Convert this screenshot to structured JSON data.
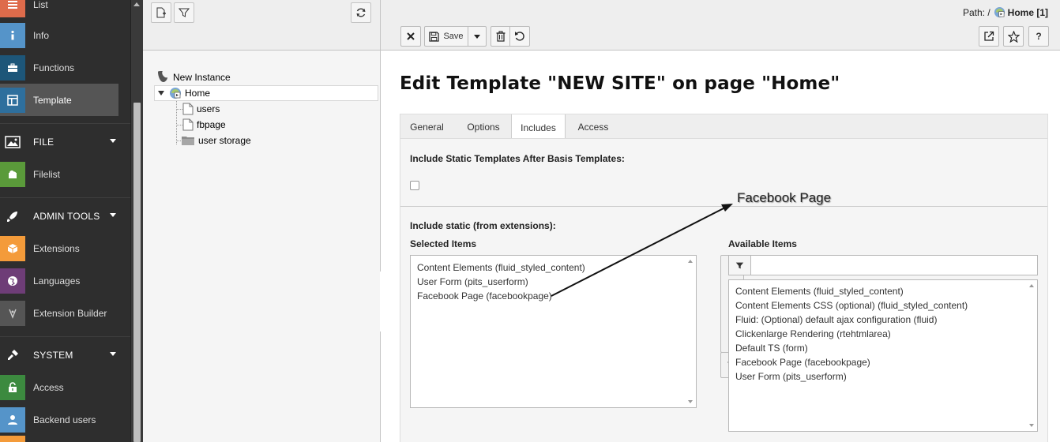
{
  "module_menu": {
    "items": [
      {
        "label": "List",
        "icon": "list-icon",
        "color": "#de6b4b"
      },
      {
        "label": "Info",
        "icon": "info-icon",
        "color": "#5594c9"
      },
      {
        "label": "Functions",
        "icon": "briefcase-icon",
        "color": "#1d5679"
      },
      {
        "label": "Template",
        "icon": "template-icon",
        "color": "#2e6f9d"
      }
    ],
    "file_group": "FILE",
    "filelist": "Filelist",
    "admin_group": "ADMIN TOOLS",
    "admin_items": [
      {
        "label": "Extensions",
        "icon": "box-icon",
        "color": "#f49b3a"
      },
      {
        "label": "Languages",
        "icon": "globe-icon",
        "color": "#6e3d77"
      },
      {
        "label": "Extension Builder",
        "icon": "wrench-icon",
        "color": "#555555"
      }
    ],
    "system_group": "SYSTEM",
    "system_items": [
      {
        "label": "Access",
        "icon": "lock-icon",
        "color": "#3c8a3f"
      },
      {
        "label": "Backend users",
        "icon": "user-icon",
        "color": "#5594c9"
      }
    ]
  },
  "tree": {
    "root": "New Instance",
    "home": "Home",
    "children": [
      "users",
      "fbpage",
      "user storage"
    ]
  },
  "header": {
    "path_prefix": "Path: /",
    "path_page": "Home [1]",
    "save_label": "Save"
  },
  "page_title": "Edit Template \"NEW SITE\" on page \"Home\"",
  "tabs": [
    "General",
    "Options",
    "Includes",
    "Access"
  ],
  "active_tab": "Includes",
  "includes": {
    "basis_label": "Include Static Templates After Basis Templates:",
    "static_label": "Include static (from extensions):",
    "selected_label": "Selected Items",
    "available_label": "Available Items",
    "selected_items": [
      "Content Elements (fluid_styled_content)",
      "User Form (pits_userform)",
      "Facebook Page (facebookpage)"
    ],
    "available_items": [
      "Content Elements (fluid_styled_content)",
      "Content Elements CSS (optional) (fluid_styled_content)",
      "Fluid: (Optional) default ajax configuration (fluid)",
      "Clickenlarge Rendering (rtehtmlarea)",
      "Default TS (form)",
      "Facebook Page (facebookpage)",
      "User Form (pits_userform)"
    ],
    "filter_value": ""
  },
  "annotation": "Facebook Page"
}
